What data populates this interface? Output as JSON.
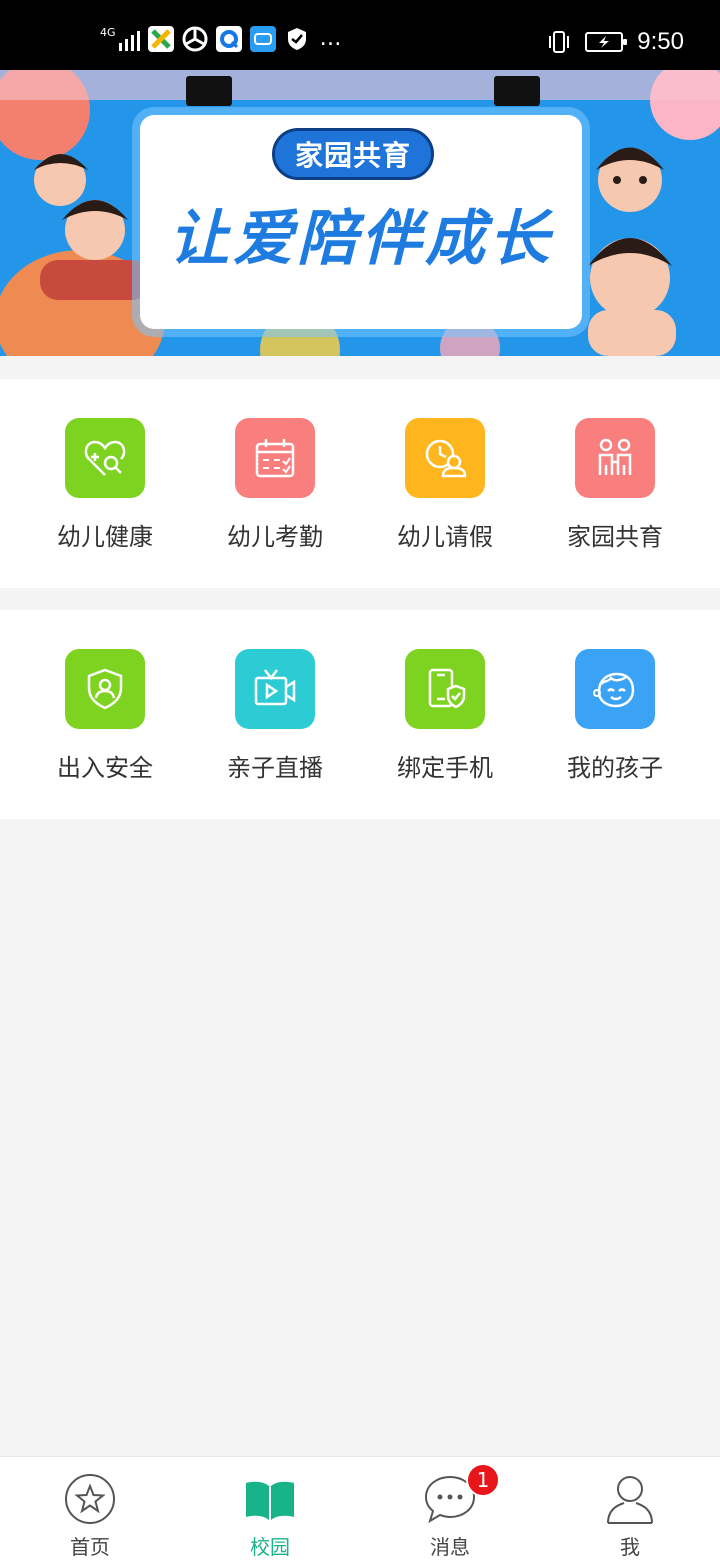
{
  "status_bar": {
    "network": "4G",
    "time": "9:50",
    "more": "…"
  },
  "banner": {
    "tag": "家园共育",
    "slogan": "让爱陪伴成长"
  },
  "grid_1": [
    {
      "label": "幼儿健康",
      "icon": "heart-search-icon",
      "color": "#7ed321"
    },
    {
      "label": "幼儿考勤",
      "icon": "calendar-check-icon",
      "color": "#f97f7f"
    },
    {
      "label": "幼儿请假",
      "icon": "clock-person-icon",
      "color": "#ffb61e"
    },
    {
      "label": "家园共育",
      "icon": "parent-child-icon",
      "color": "#f97f7f"
    }
  ],
  "grid_2": [
    {
      "label": "出入安全",
      "icon": "shield-user-icon",
      "color": "#7ed321"
    },
    {
      "label": "亲子直播",
      "icon": "tv-play-icon",
      "color": "#2dcbd3"
    },
    {
      "label": "绑定手机",
      "icon": "phone-shield-icon",
      "color": "#7ed321"
    },
    {
      "label": "我的孩子",
      "icon": "child-face-icon",
      "color": "#3aa3f5"
    }
  ],
  "tabs": [
    {
      "label": "首页",
      "icon": "star-circle-icon"
    },
    {
      "label": "校园",
      "icon": "open-book-icon",
      "active": true
    },
    {
      "label": "消息",
      "icon": "chat-bubble-icon",
      "badge": "1"
    },
    {
      "label": "我",
      "icon": "person-icon"
    }
  ],
  "colors": {
    "accent": "#19b38a",
    "badge": "#e8151b",
    "background": "#f4f4f4"
  }
}
